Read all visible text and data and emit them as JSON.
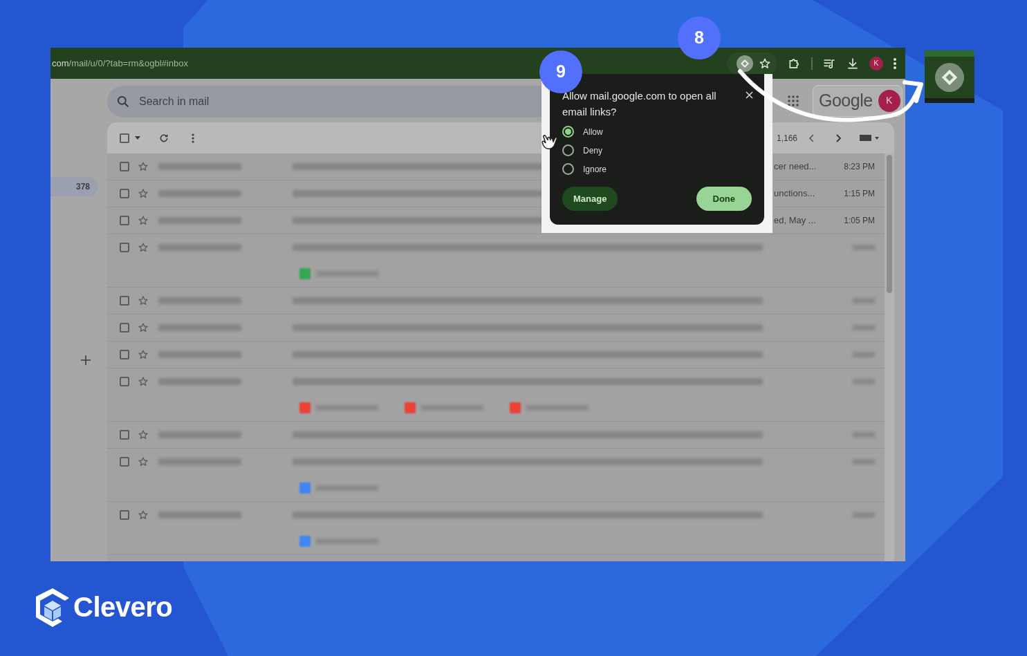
{
  "browser": {
    "url_host": "com",
    "url_path": "/mail/u/0/?tab=rm&ogbl#inbox",
    "avatar_letter": "K"
  },
  "sidebar": {
    "unread_count": "378"
  },
  "search": {
    "placeholder": "Search in mail"
  },
  "account": {
    "brand": "Google",
    "avatar_letter": "K"
  },
  "toolbar": {
    "select_all_checked": false
  },
  "pager": {
    "count": "1,166"
  },
  "rows": [
    {
      "checked": false,
      "snippet_end": "cer need...",
      "time": "8:23 PM",
      "attachments": []
    },
    {
      "checked": false,
      "snippet_end": "unctions...",
      "time": "1:15 PM",
      "attachments": []
    },
    {
      "checked": false,
      "snippet_end": "ed, May ...",
      "time": "1:05 PM",
      "attachments": []
    },
    {
      "checked": false,
      "attachments": [
        {
          "color": "#34a853"
        }
      ]
    },
    {
      "checked": false,
      "attachments": []
    },
    {
      "checked": false,
      "attachments": []
    },
    {
      "checked": false,
      "attachments": []
    },
    {
      "checked": false,
      "attachments": [
        {
          "color": "#ea4335"
        },
        {
          "color": "#ea4335"
        },
        {
          "color": "#ea4335"
        }
      ]
    },
    {
      "checked": false,
      "attachments": []
    },
    {
      "checked": false,
      "attachments": [
        {
          "color": "#4285f4"
        }
      ]
    },
    {
      "checked": false,
      "attachments": [
        {
          "color": "#4285f4"
        }
      ]
    }
  ],
  "popup": {
    "title": "Allow mail.google.com to open all email links?",
    "options": [
      {
        "label": "Allow",
        "selected": true
      },
      {
        "label": "Deny",
        "selected": false
      },
      {
        "label": "Ignore",
        "selected": false
      }
    ],
    "buttons": [
      {
        "label": "Manage",
        "kind": "secondary"
      },
      {
        "label": "Done",
        "kind": "primary"
      }
    ]
  },
  "steps": [
    {
      "number": "8"
    },
    {
      "number": "9"
    }
  ],
  "brand": {
    "name": "Clevero"
  }
}
